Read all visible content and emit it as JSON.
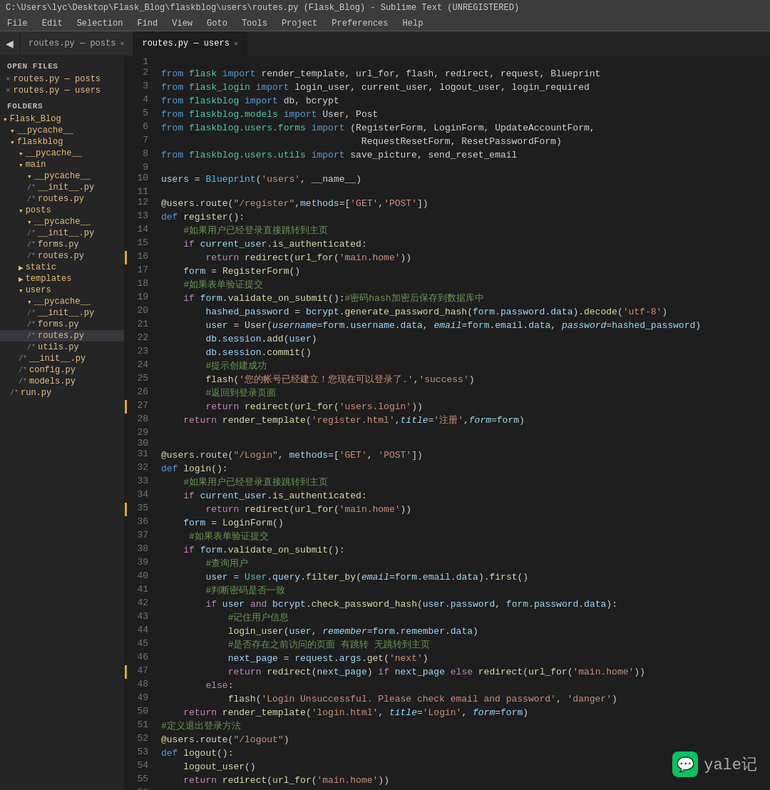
{
  "titleBar": {
    "text": "C:\\Users\\lyc\\Desktop\\Flask_Blog\\flaskblog\\users\\routes.py (Flask_Blog) - Sublime Text (UNREGISTERED)"
  },
  "menuBar": {
    "items": [
      "File",
      "Edit",
      "Selection",
      "Find",
      "View",
      "Goto",
      "Tools",
      "Project",
      "Preferences",
      "Help"
    ]
  },
  "tabs": [
    {
      "label": "routes.py",
      "sublabel": "posts",
      "active": false
    },
    {
      "label": "routes.py",
      "sublabel": "users",
      "active": true
    }
  ],
  "sidebar": {
    "openFiles": {
      "title": "OPEN FILES",
      "items": [
        {
          "label": "routes.py — posts",
          "indent": 0,
          "icon": "×",
          "type": "py"
        },
        {
          "label": "routes.py — users",
          "indent": 0,
          "icon": "×",
          "type": "py"
        }
      ]
    },
    "folders": {
      "title": "FOLDERS",
      "tree": [
        {
          "label": "Flask_Blog",
          "indent": 0,
          "icon": "▾",
          "type": "folder"
        },
        {
          "label": "__pycache__",
          "indent": 1,
          "icon": "▾",
          "type": "folder"
        },
        {
          "label": "flaskblog",
          "indent": 1,
          "icon": "▾",
          "type": "folder"
        },
        {
          "label": "__pycache__",
          "indent": 2,
          "icon": "▾",
          "type": "folder"
        },
        {
          "label": "main",
          "indent": 2,
          "icon": "▾",
          "type": "folder"
        },
        {
          "label": "__pycache__",
          "indent": 3,
          "icon": "▾",
          "type": "folder"
        },
        {
          "label": "__init__.py",
          "indent": 3,
          "icon": "/*",
          "type": "py"
        },
        {
          "label": "routes.py",
          "indent": 3,
          "icon": "/*",
          "type": "py"
        },
        {
          "label": "posts",
          "indent": 2,
          "icon": "▾",
          "type": "folder"
        },
        {
          "label": "__pycache__",
          "indent": 3,
          "icon": "▾",
          "type": "folder"
        },
        {
          "label": "__init__.py",
          "indent": 3,
          "icon": "/*",
          "type": "py"
        },
        {
          "label": "forms.py",
          "indent": 3,
          "icon": "/*",
          "type": "py"
        },
        {
          "label": "routes.py",
          "indent": 3,
          "icon": "/*",
          "type": "py"
        },
        {
          "label": "static",
          "indent": 2,
          "icon": "▶",
          "type": "folder"
        },
        {
          "label": "templates",
          "indent": 2,
          "icon": "▶",
          "type": "folder"
        },
        {
          "label": "users",
          "indent": 2,
          "icon": "▾",
          "type": "folder"
        },
        {
          "label": "__pycache__",
          "indent": 3,
          "icon": "▾",
          "type": "folder"
        },
        {
          "label": "__init__.py",
          "indent": 3,
          "icon": "/*",
          "type": "py"
        },
        {
          "label": "forms.py",
          "indent": 3,
          "icon": "/*",
          "type": "py"
        },
        {
          "label": "routes.py",
          "indent": 3,
          "icon": "/*",
          "type": "py",
          "active": true
        },
        {
          "label": "utils.py",
          "indent": 3,
          "icon": "/*",
          "type": "py"
        },
        {
          "label": "__init__.py",
          "indent": 2,
          "icon": "/*",
          "type": "py"
        },
        {
          "label": "config.py",
          "indent": 2,
          "icon": "/*",
          "type": "py"
        },
        {
          "label": "models.py",
          "indent": 2,
          "icon": "/*",
          "type": "py"
        },
        {
          "label": "run.py",
          "indent": 1,
          "icon": "/*",
          "type": "py"
        }
      ]
    }
  },
  "watermark": {
    "icon": "💬",
    "text": "yale记"
  }
}
